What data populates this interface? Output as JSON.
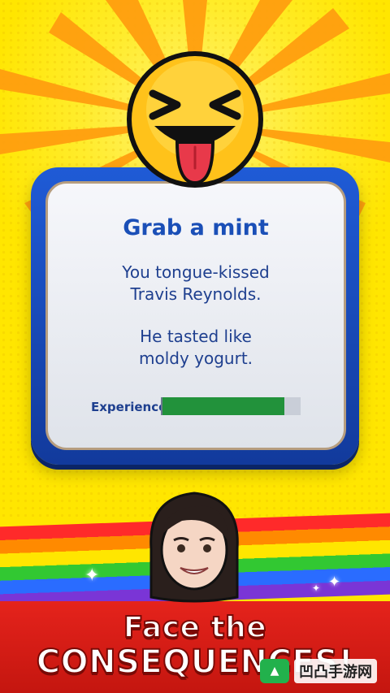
{
  "card": {
    "title": "Grab a mint",
    "line1": "You tongue-kissed",
    "line2": "Travis Reynolds.",
    "line3": "He tasted like",
    "line4": "moldy yogurt.",
    "experience_label": "Experience",
    "experience_progress": 0.88
  },
  "promo": {
    "line1": "Face the",
    "line2": "CONSEQUENCES!"
  },
  "watermark": {
    "text": "凹凸手游网"
  },
  "icons": {
    "top_emoji": "tongue-out-squint-emoji",
    "avatar": "woman-avatar",
    "sparkles": "sparkle-icon"
  },
  "colors": {
    "background": "#ffe600",
    "card_border": "#1f5bd6",
    "title": "#1a4fb7",
    "bar_fill": "#22923b",
    "bottom_band": "#e5231c"
  }
}
